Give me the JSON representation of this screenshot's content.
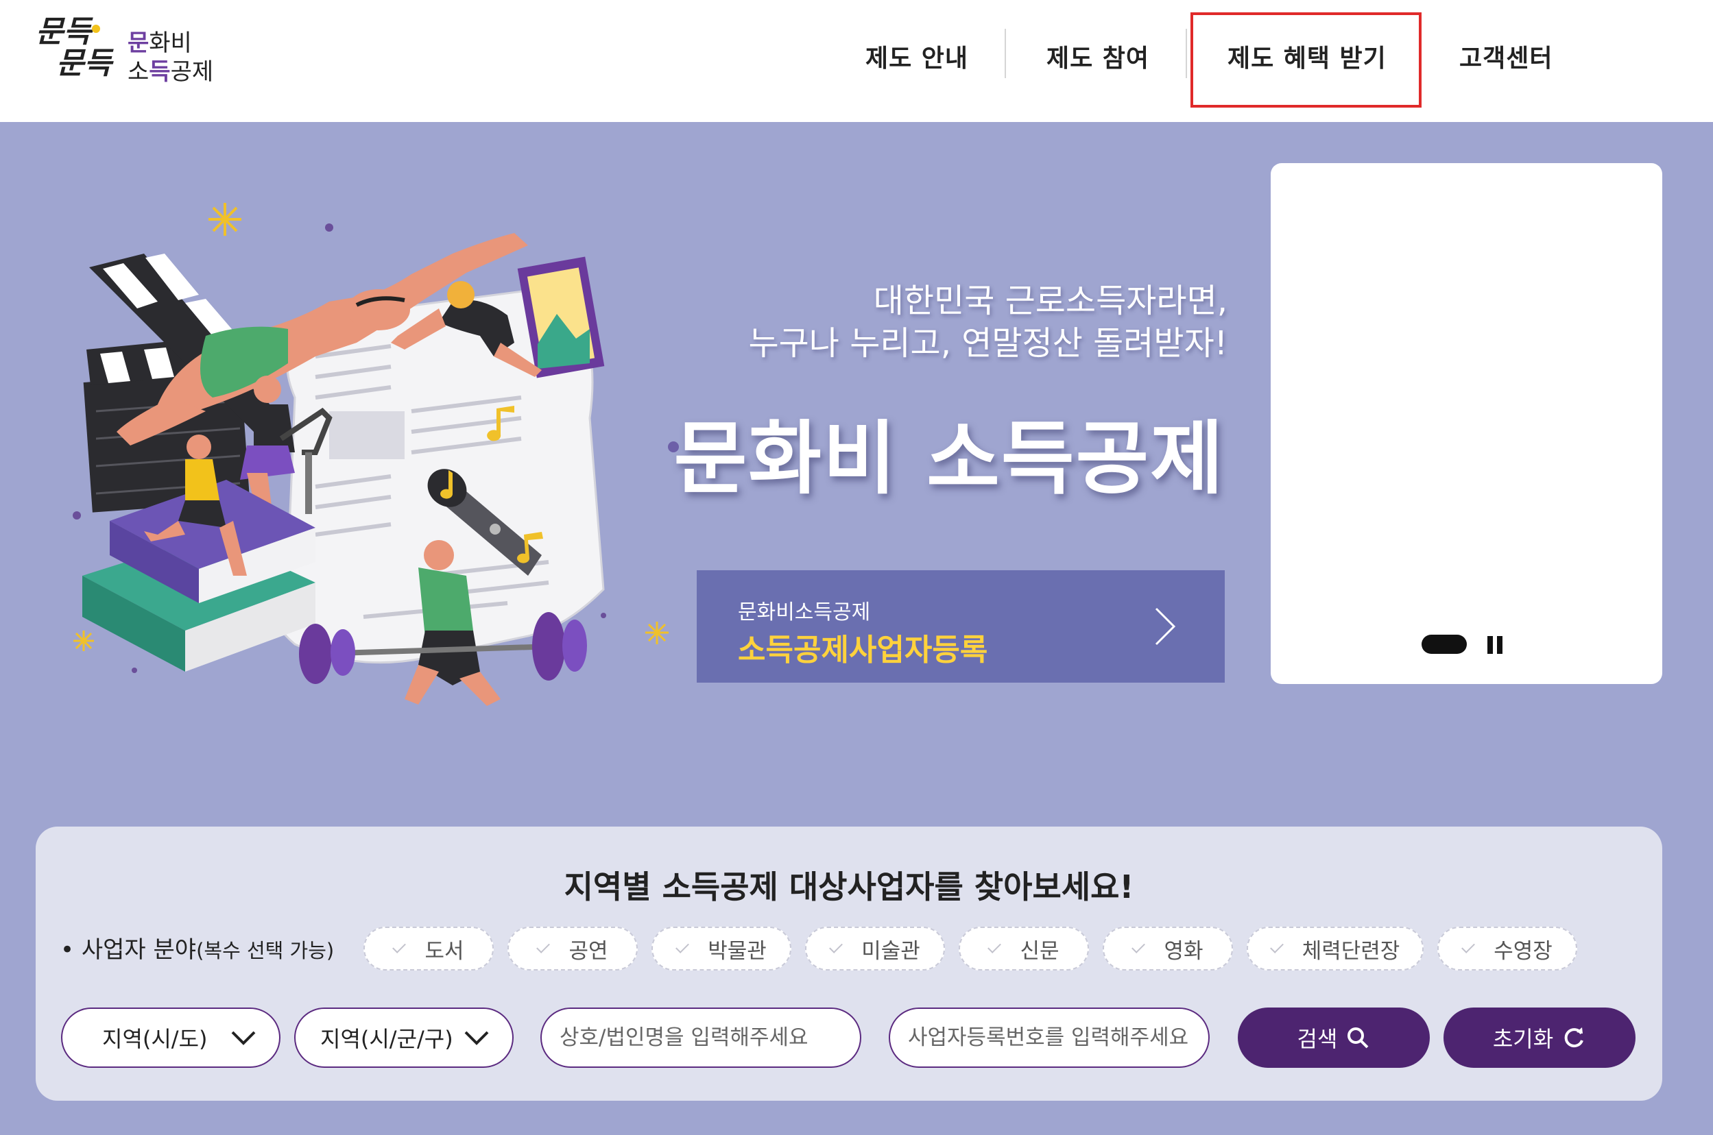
{
  "header": {
    "logo_mark_line1": "문득",
    "logo_mark_line2": "문득",
    "logo_text_line1_highlight": "문",
    "logo_text_line1_rest": "화비",
    "logo_text_line2_a": "소",
    "logo_text_line2_highlight": "득",
    "logo_text_line2_rest": "공제"
  },
  "nav": {
    "items": [
      {
        "label": "제도 안내"
      },
      {
        "label": "제도 참여"
      },
      {
        "label": "제도 혜택 받기"
      },
      {
        "label": "고객센터"
      }
    ],
    "highlight_color": "#e02a2a"
  },
  "hero": {
    "tagline_line1": "대한민국 근로소득자라면,",
    "tagline_line2": "누구나 누리고, 연말정산 돌려받자!",
    "title": "문화비 소득공제",
    "register_sub": "문화비소득공제",
    "register_main": "소득공제사업자등록",
    "register_color": "#ffd23c",
    "background_color": "#9fa5d0"
  },
  "search": {
    "title": "지역별 소득공제 대상사업자를 찾아보세요!",
    "category_label": "• 사업자 분야",
    "category_note": "(복수 선택 가능)",
    "categories": [
      "도서",
      "공연",
      "박물관",
      "미술관",
      "신문",
      "영화",
      "체력단련장",
      "수영장"
    ],
    "region_sido": "지역(시/도)",
    "region_sigungu": "지역(시/군/구)",
    "name_placeholder": "상호/법인명을 입력해주세요",
    "biz_no_placeholder": "사업자등록번호를 입력해주세요",
    "search_button": "검색",
    "reset_button": "초기화",
    "accent_color": "#4d2470"
  },
  "icons": [
    "chevron-down-icon",
    "chevron-right-icon",
    "search-icon",
    "refresh-icon",
    "pause-icon"
  ]
}
